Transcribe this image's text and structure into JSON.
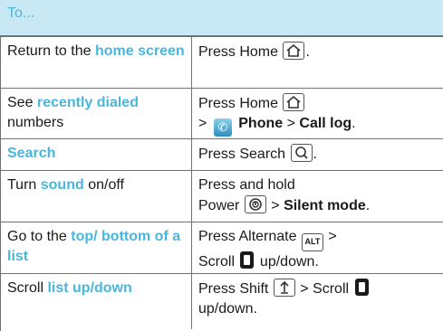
{
  "header": {
    "label": "To..."
  },
  "rows": [
    {
      "left_pre": "Return to the ",
      "left_hl": "home screen",
      "left_post": "",
      "right": {
        "press": "Press Home",
        "end": "."
      }
    },
    {
      "left_pre": "See ",
      "left_hl": "recently dialed",
      "left_post": " numbers",
      "right": {
        "press": "Press Home",
        "sep1": ">",
        "phone": "Phone",
        "sep2": ">",
        "calllog": "Call log",
        "end": "."
      }
    },
    {
      "left_pre": "",
      "left_hl": "Search",
      "left_post": "",
      "right": {
        "press": "Press Search",
        "end": "."
      }
    },
    {
      "left_pre": "Turn ",
      "left_hl": "sound",
      "left_post": " on/off",
      "right": {
        "press": "Press and hold",
        "power": "Power",
        "sep": ">",
        "mode": "Silent mode",
        "end": "."
      }
    },
    {
      "left_pre": "Go to the ",
      "left_hl": "top/ bottom of a list",
      "left_post": "",
      "right": {
        "press": "Press Alternate",
        "key": "ALT",
        "sep": ">",
        "scroll": "Scroll",
        "dir": "up/down."
      }
    },
    {
      "left_pre": "Scroll ",
      "left_hl": "list up/down",
      "left_post": "",
      "right": {
        "press": "Press Shift",
        "sep": "> Scroll",
        "dir": "up/down."
      }
    }
  ],
  "icons": {
    "home": "home-icon",
    "search": "search-icon",
    "phone": "phone-icon",
    "power": "power-icon",
    "shift": "shift-arrow-icon",
    "scroll": "scroll-ball-icon"
  },
  "colors": {
    "header_bg": "#c8e8f3",
    "accent": "#49b6dd",
    "rule": "#6f7376"
  }
}
